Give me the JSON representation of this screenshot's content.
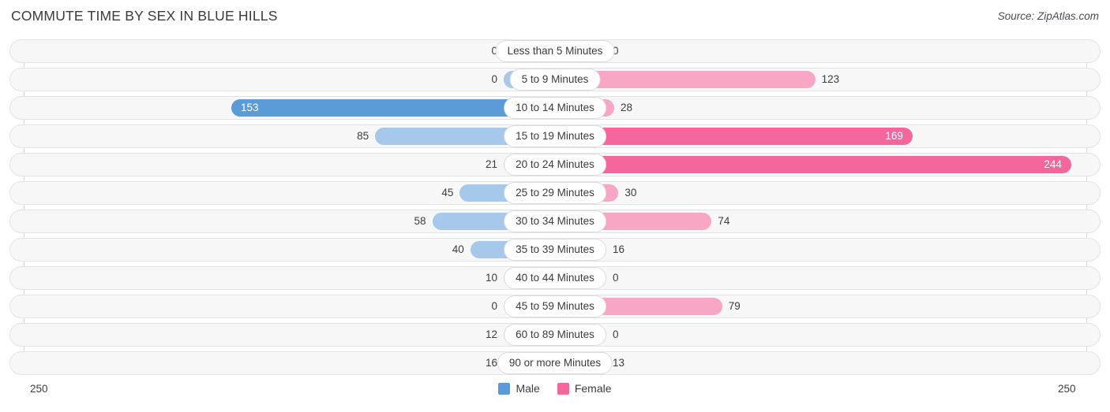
{
  "header": {
    "title": "COMMUTE TIME BY SEX IN BLUE HILLS",
    "source": "Source: ZipAtlas.com"
  },
  "legend": {
    "male_label": "Male",
    "female_label": "Female",
    "male_color": "#5a9bd8",
    "female_color": "#f4679c"
  },
  "axis": {
    "min_label": "250",
    "max_label": "250",
    "max_value": 250
  },
  "chart_data": {
    "type": "bar",
    "subtype": "diverging-bidirectional-bar",
    "title": "COMMUTE TIME BY SEX IN BLUE HILLS",
    "xlabel": "",
    "ylabel": "",
    "xlim": [
      -250,
      250
    ],
    "grid": true,
    "legend_position": "bottom-center",
    "categories": [
      "Less than 5 Minutes",
      "5 to 9 Minutes",
      "10 to 14 Minutes",
      "15 to 19 Minutes",
      "20 to 24 Minutes",
      "25 to 29 Minutes",
      "30 to 34 Minutes",
      "35 to 39 Minutes",
      "40 to 44 Minutes",
      "45 to 59 Minutes",
      "60 to 89 Minutes",
      "90 or more Minutes"
    ],
    "series": [
      {
        "name": "Male",
        "direction": "left",
        "values": [
          0,
          0,
          153,
          85,
          21,
          45,
          58,
          40,
          10,
          0,
          12,
          16
        ]
      },
      {
        "name": "Female",
        "direction": "right",
        "values": [
          0,
          123,
          28,
          169,
          244,
          30,
          74,
          16,
          0,
          79,
          0,
          13
        ]
      }
    ],
    "value_labels": {
      "male": [
        "0",
        "0",
        "153",
        "85",
        "21",
        "45",
        "58",
        "40",
        "10",
        "0",
        "12",
        "16"
      ],
      "female": [
        "0",
        "123",
        "28",
        "169",
        "244",
        "30",
        "74",
        "16",
        "0",
        "79",
        "0",
        "13"
      ]
    }
  }
}
